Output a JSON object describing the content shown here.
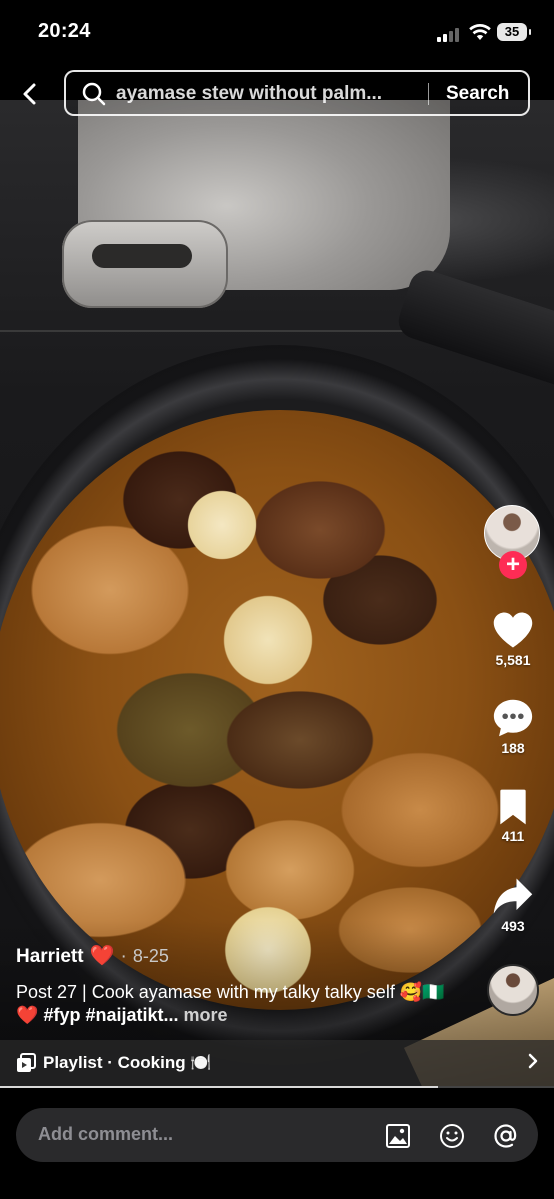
{
  "status_bar": {
    "time": "20:24",
    "battery": "35"
  },
  "search": {
    "query": "ayamase stew without palm...",
    "button_label": "Search"
  },
  "rail": {
    "likes": "5,581",
    "comments": "188",
    "saves": "411",
    "shares": "493"
  },
  "post": {
    "author": "Harriett",
    "author_emoji": "❤️",
    "dot": "·",
    "date": "8-25",
    "caption_text": "Post 27 | Cook ayamase with my talky talky self 🥰🇳🇬❤️",
    "hashtags": "#fyp #naijatikt...",
    "more_label": "more"
  },
  "playlist": {
    "label": "Playlist · Cooking 🍽️",
    "progress": 0.79
  },
  "comment": {
    "placeholder": "Add comment..."
  },
  "colors": {
    "accent": "#fe2c55",
    "heart_red": "#e0303a"
  },
  "icons": [
    "back-icon",
    "search-icon",
    "heart-icon",
    "comment-icon",
    "bookmark-icon",
    "share-icon",
    "playlist-icon",
    "chevron-right-icon",
    "image-icon",
    "emoji-icon",
    "mention-icon"
  ]
}
